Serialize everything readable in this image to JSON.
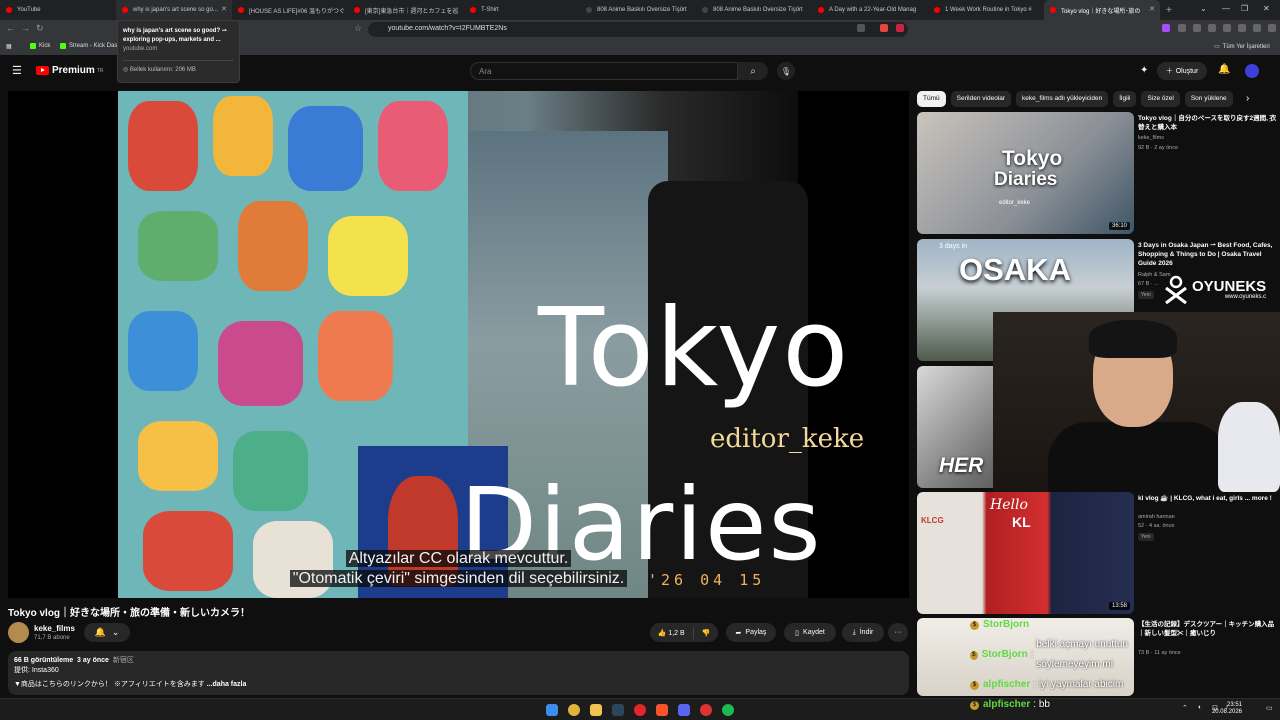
{
  "browser": {
    "tabs": [
      {
        "label": "YouTube",
        "active": false
      },
      {
        "label": "why is japan's art scene so go...",
        "active": false
      },
      {
        "label": "[HOUSE AS LIFE]#06 温もりがつぐ",
        "active": false
      },
      {
        "label": "[東京]東急台市｜週河とカフェを巡",
        "active": false
      },
      {
        "label": "T-Shirt",
        "active": false
      },
      {
        "label": "808 Anime Baskılı Oversize Tişört",
        "active": false
      },
      {
        "label": "808 Anime Baskılı Oversize Tişört",
        "active": false
      },
      {
        "label": "A Day with a 22-Year-Old Manag",
        "active": false
      },
      {
        "label": "1 Week Work Routine in Tokyo #",
        "active": false
      },
      {
        "label": "Tokyo vlog｜好きな場所･旅の",
        "active": true
      }
    ],
    "url": "youtube.com/watch?v=I2FUMBTE2Ns",
    "bookmarks": [
      "Kick",
      "Stream - Kick Das"
    ],
    "all_bookmarks_label": "Tüm Yer İşaretleri",
    "tooltip": {
      "title": "why is japan's art scene so good? ⇀ exploring pop-ups, markets and ...",
      "domain": "youtube.com",
      "memory": "Bellek kullanımı: 206 MB"
    }
  },
  "youtube": {
    "logo": "Premium",
    "logo_region": "TR",
    "search_placeholder": "Ara",
    "create_label": "Oluştur",
    "video": {
      "overlay_title_1": "Tokyo",
      "overlay_title_2": "Diaries",
      "overlay_credit": "editor_keke",
      "subtitle_1": "Altyazılar CC olarak mevcuttur.",
      "subtitle_2": "\"Otomatik çeviri\" simgesinden dil seçebilirsiniz.",
      "date_stamp": "'26 04 15"
    },
    "title": "Tokyo vlog｜好きな場所・旅の準備・新しいカメラ！",
    "channel": {
      "name": "keke_films",
      "subscribers": "71,7 B abone"
    },
    "actions": {
      "likes": "1,2 B",
      "share": "Paylaş",
      "save": "Kaydet",
      "download": "İndir",
      "more": "···"
    },
    "description": {
      "views": "66 B görüntüleme",
      "age": "3 ay önce",
      "tag": "新宿区",
      "sponsor": "提供: Insta360",
      "line": "▼商品はこちらのリンクから！ ※アフィリエイトを含みます",
      "more": "...daha fazla"
    },
    "chips": [
      "Tümü",
      "Serilden videolar",
      "keke_films adlı yükleyiciden",
      "İlgili",
      "Size özel",
      "Son yüklene"
    ],
    "recommendations": [
      {
        "title": "Tokyo vlog｜自分のペースを取り戻す2週間, 衣替えと購入本",
        "channel": "keke_films",
        "meta": "92 B · 2 ay önce",
        "duration": "36:10",
        "thumb_text_1": "Tokyo",
        "thumb_text_2": "Diaries",
        "thumb_sub": "editor_keke"
      },
      {
        "title": "3 Days in Osaka Japan ⇀ Best Food, Cafes, Shopping & Things to Do | Osaka Travel Guide 2026",
        "channel": "Ralph & Sam",
        "meta": "67 B · ...",
        "badge": "Yeni",
        "thumb_top": "3 days in",
        "thumb_text_1": "OSAKA"
      },
      {
        "title": "",
        "channel": "",
        "meta": "",
        "thumb_text_1": "HER"
      },
      {
        "title": "kl vlog ☕ | KLCG, what i eat, girls ... more !",
        "channel": "amirah hannan",
        "meta": "52 · 4 sa. önce",
        "badge": "Yeni",
        "duration": "13:58",
        "thumb_text_1": "Hello",
        "thumb_text_2": "KL",
        "thumb_sign": "KLCG"
      },
      {
        "title": "【生活の記録】デスクツアー｜キッチン購入品｜新しい髪型✂｜癒いじり",
        "channel": "",
        "meta": "73 B · 11 ay önce"
      }
    ]
  },
  "stream_overlay": {
    "brand": "OYUNEKS",
    "brand_url": "www.oyuneks.c",
    "chat": [
      {
        "user": "StorBjorn",
        "text": "",
        "user_color": "#62d943"
      },
      {
        "user": "StorBjorn",
        "text": "belki açmayı unuttun söylemeyeyim mi",
        "user_color": "#62d943"
      },
      {
        "user": "alpfischer",
        "text": "iyi yaymalar abicim",
        "user_color": "#62d943"
      },
      {
        "user": "alpfischer",
        "text": "bb",
        "user_color": "#62d943"
      }
    ]
  },
  "taskbar": {
    "time": "23:51",
    "date": "20.08.2026"
  },
  "colors": {
    "yt_red": "#ff0000",
    "bg": "#0f0f0f",
    "chip_bg": "#272727",
    "kick_green": "#53fc18"
  }
}
